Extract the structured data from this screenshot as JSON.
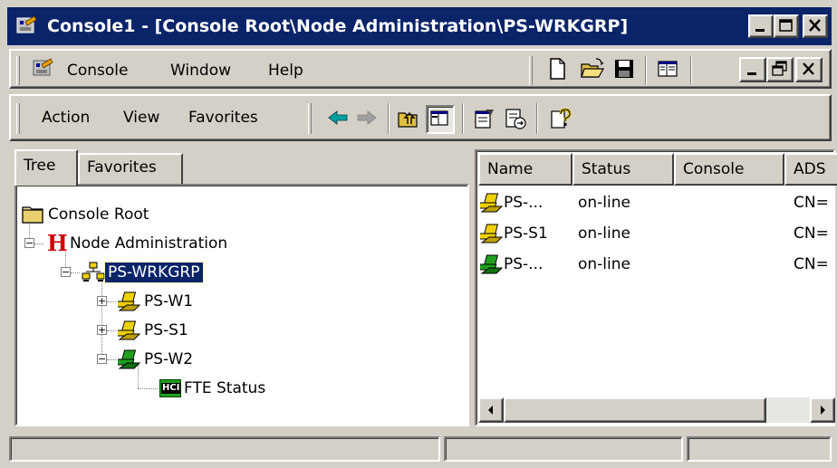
{
  "window": {
    "title": "Console1 - [Console Root\\Node Administration\\PS-WRKGRP]"
  },
  "menubar": {
    "items": [
      "Console",
      "Window",
      "Help"
    ]
  },
  "actionbar": {
    "items": [
      "Action",
      "View",
      "Favorites"
    ]
  },
  "tabs": [
    "Tree",
    "Favorites"
  ],
  "tree": {
    "root": "Console Root",
    "node_admin": "Node Administration",
    "workgroup": "PS-WRKGRP",
    "w1": "PS-W1",
    "s1": "PS-S1",
    "w2": "PS-W2",
    "fte": "FTE Status",
    "fte_icon_text": "HCI",
    "node_admin_icon_text": "H"
  },
  "list": {
    "columns": [
      "Name",
      "Status",
      "Console",
      "ADS"
    ],
    "rows": [
      {
        "name": "PS-...",
        "status": "on-line",
        "ads": "CN=",
        "color": "yellow"
      },
      {
        "name": "PS-S1",
        "status": "on-line",
        "ads": "CN=",
        "color": "yellow"
      },
      {
        "name": "PS-...",
        "status": "on-line",
        "ads": "CN=",
        "color": "green"
      }
    ]
  },
  "colors": {
    "title_bg": "#0a246a",
    "selection": "#0a246a",
    "face": "#d4d0c8",
    "node_yellow": "#f0d000",
    "node_green": "#20a020",
    "hci_red": "#cc0000"
  }
}
